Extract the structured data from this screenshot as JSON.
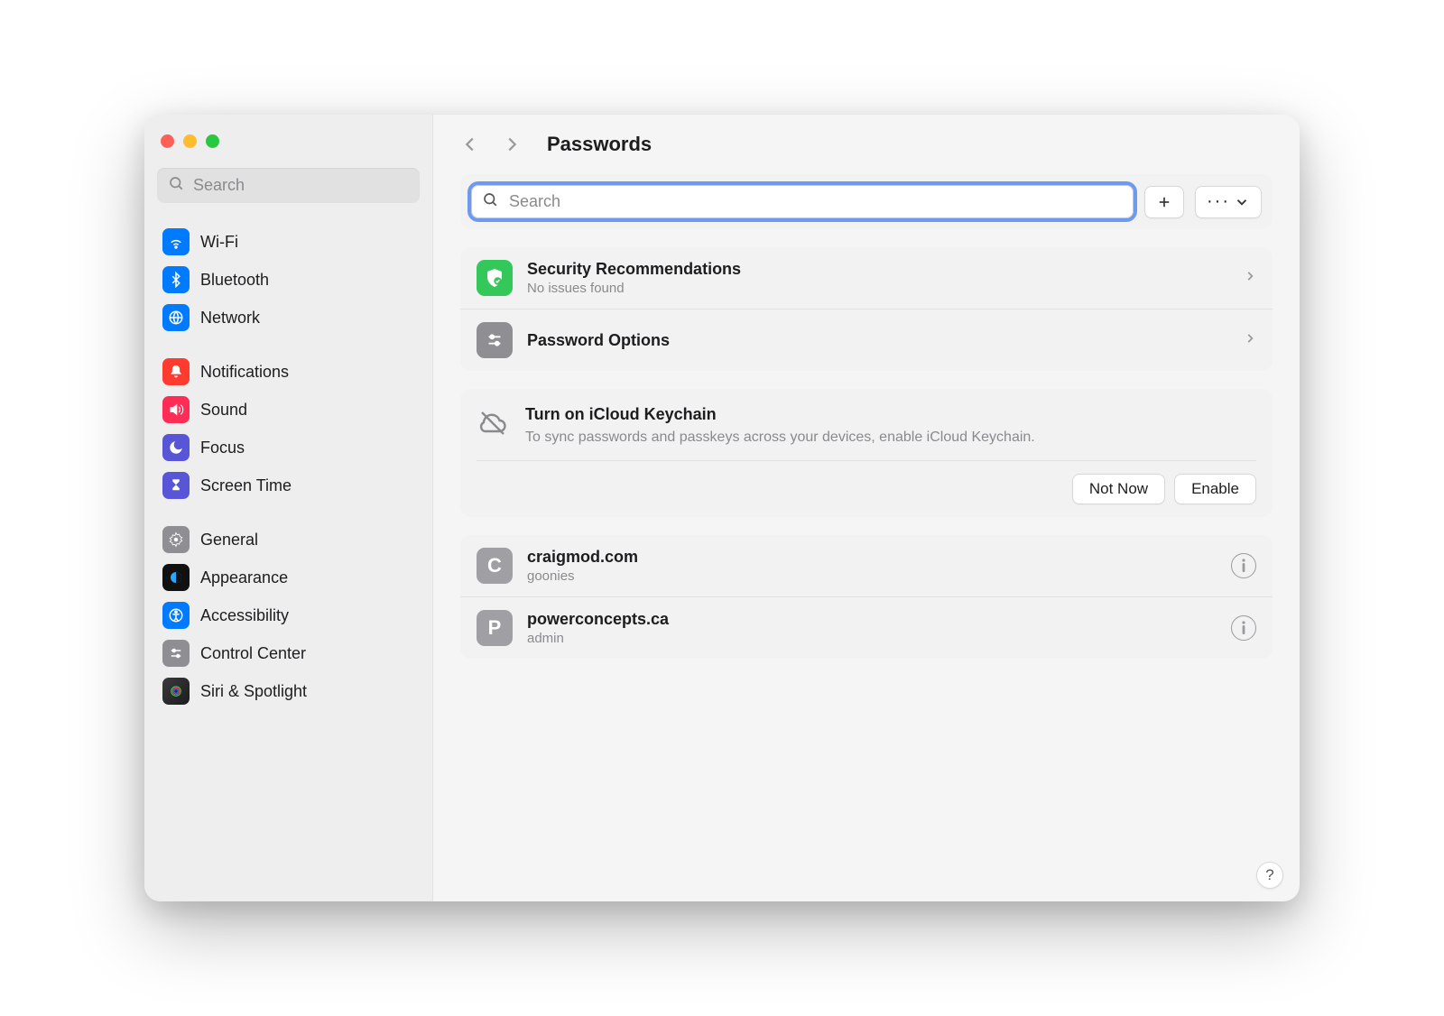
{
  "header": {
    "title": "Passwords"
  },
  "sidebar": {
    "search_placeholder": "Search",
    "groups": [
      [
        {
          "id": "wifi",
          "label": "Wi-Fi",
          "icon": "wifi-icon",
          "color": "#007aff"
        },
        {
          "id": "bluetooth",
          "label": "Bluetooth",
          "icon": "bluetooth-icon",
          "color": "#007aff"
        },
        {
          "id": "network",
          "label": "Network",
          "icon": "globe-icon",
          "color": "#007aff"
        }
      ],
      [
        {
          "id": "notifications",
          "label": "Notifications",
          "icon": "bell-icon",
          "color": "#ff3b30"
        },
        {
          "id": "sound",
          "label": "Sound",
          "icon": "speaker-icon",
          "color": "#ff2d55"
        },
        {
          "id": "focus",
          "label": "Focus",
          "icon": "moon-icon",
          "color": "#5856d6"
        },
        {
          "id": "screentime",
          "label": "Screen Time",
          "icon": "hourglass-icon",
          "color": "#5856d6"
        }
      ],
      [
        {
          "id": "general",
          "label": "General",
          "icon": "gear-icon",
          "color": "#8e8e93"
        },
        {
          "id": "appearance",
          "label": "Appearance",
          "icon": "appearance-icon",
          "color": "#111111"
        },
        {
          "id": "accessibility",
          "label": "Accessibility",
          "icon": "accessibility-icon",
          "color": "#007aff"
        },
        {
          "id": "controlcenter",
          "label": "Control Center",
          "icon": "sliders-icon",
          "color": "#8e8e93"
        },
        {
          "id": "siri",
          "label": "Siri & Spotlight",
          "icon": "siri-icon",
          "color": "#222222"
        }
      ]
    ]
  },
  "toolbar": {
    "search_placeholder": "Search",
    "add_label": "+",
    "more_label": "···"
  },
  "security": {
    "title": "Security Recommendations",
    "subtitle": "No issues found",
    "options_label": "Password Options"
  },
  "keychain": {
    "title": "Turn on iCloud Keychain",
    "subtitle": "To sync passwords and passkeys across your devices, enable iCloud Keychain.",
    "not_now": "Not Now",
    "enable": "Enable"
  },
  "entries": [
    {
      "monogram": "C",
      "site": "craigmod.com",
      "user": "goonies"
    },
    {
      "monogram": "P",
      "site": "powerconcepts.ca",
      "user": "admin"
    }
  ],
  "help_label": "?"
}
